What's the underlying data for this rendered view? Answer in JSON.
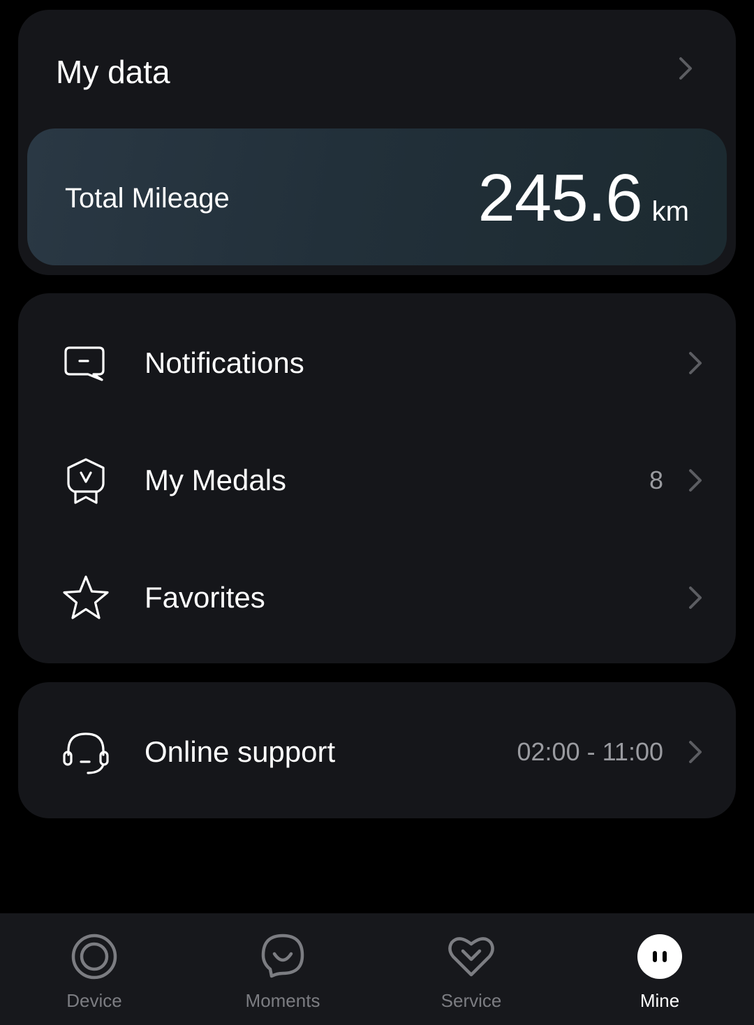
{
  "my_data": {
    "title": "My data",
    "total_mileage": {
      "label": "Total Mileage",
      "value": "245.6",
      "unit": "km"
    }
  },
  "menu": {
    "items": [
      {
        "label": "Notifications",
        "value": "",
        "icon": "message-icon"
      },
      {
        "label": "My Medals",
        "value": "8",
        "icon": "medal-icon"
      },
      {
        "label": "Favorites",
        "value": "",
        "icon": "star-icon"
      }
    ]
  },
  "support": {
    "label": "Online support",
    "hours": "02:00 - 11:00",
    "icon": "headset-icon"
  },
  "tabbar": {
    "tabs": [
      {
        "label": "Device",
        "icon": "device-ring-icon",
        "active": false
      },
      {
        "label": "Moments",
        "icon": "smile-bubble-icon",
        "active": false
      },
      {
        "label": "Service",
        "icon": "heart-icon",
        "active": false
      },
      {
        "label": "Mine",
        "icon": "mine-face-icon",
        "active": true
      }
    ]
  },
  "colors": {
    "background": "#000000",
    "card": "#15161a",
    "mileage_card": "#22303a",
    "muted_text": "#9a9ba0",
    "tab_inactive": "#7c7d82",
    "tab_active": "#ffffff"
  }
}
